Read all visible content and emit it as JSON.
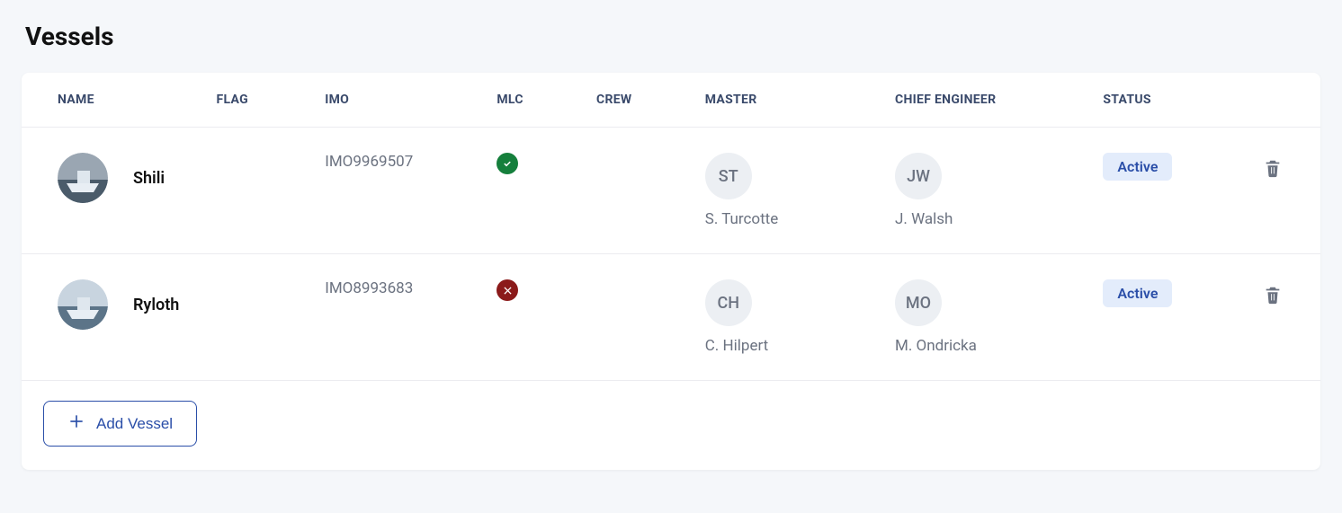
{
  "page": {
    "title": "Vessels"
  },
  "columns": {
    "name": "NAME",
    "flag": "FLAG",
    "imo": "IMO",
    "mlc": "MLC",
    "crew": "CREW",
    "master": "MASTER",
    "chief_engineer": "CHIEF ENGINEER",
    "status": "STATUS"
  },
  "vessels": [
    {
      "name": "Shili",
      "flag": "",
      "imo": "IMO9969507",
      "mlc_ok": true,
      "crew": "",
      "master": {
        "initials": "ST",
        "name": "S. Turcotte"
      },
      "chief_engineer": {
        "initials": "JW",
        "name": "J. Walsh"
      },
      "status": "Active",
      "avatar_colors": {
        "a": "#9aa6b2",
        "b": "#4a5b6a"
      }
    },
    {
      "name": "Ryloth",
      "flag": "",
      "imo": "IMO8993683",
      "mlc_ok": false,
      "crew": "",
      "master": {
        "initials": "CH",
        "name": "C. Hilpert"
      },
      "chief_engineer": {
        "initials": "MO",
        "name": "M. Ondricka"
      },
      "status": "Active",
      "avatar_colors": {
        "a": "#c8d4df",
        "b": "#5c7488"
      }
    }
  ],
  "actions": {
    "add_vessel": "Add Vessel"
  },
  "icons": {
    "mlc_ok": "check-circle-icon",
    "mlc_bad": "x-circle-icon",
    "delete": "trash-icon",
    "add": "plus-icon"
  },
  "colors": {
    "accent": "#2a4ea8",
    "badge_bg": "#e3ecfb",
    "ok": "#157f3c",
    "bad": "#8b1a1a"
  }
}
